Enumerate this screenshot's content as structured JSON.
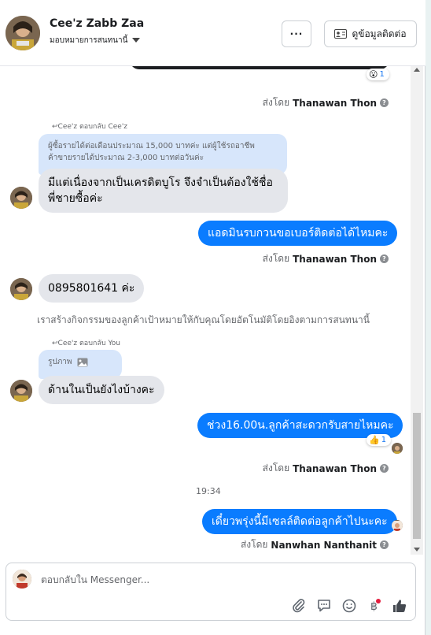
{
  "header": {
    "name": "Cee'z Zabb Zaa",
    "assign": "มอบหมายการสนทนานี้",
    "more_label": "···",
    "contact_label": "ดูข้อมูลติดต่อ"
  },
  "messages": {
    "reaction1": {
      "emoji": "😮",
      "count": "1"
    },
    "sent1": {
      "prefix": "ส่งโดย",
      "name": "Thanawan Thon"
    },
    "reply1_label": "Cee'z ตอบกลับ Cee'z",
    "quote1": "ผู้ซื้อรายได้ต่อเดือนประมาณ 15,000 บาทค่ะ แต่ผู้ใช้รถอาชีพค้าขายรายได้ประมาณ 2-3,000 บาทต่อวันค่ะ",
    "msg_in1": "มีแต่เนื่องจากเป็นเครดิตบูโร  จึงจำเป็นต้องใช้ชื่อพี่ชายซื้อค่ะ",
    "msg_out1": "แอดมินรบกวนขอเบอร์ติดต่อได้ไหมคะ",
    "sent2": {
      "prefix": "ส่งโดย",
      "name": "Thanawan Thon"
    },
    "msg_in2": "0895801641  ค่ะ",
    "system": "เราสร้างกิจกรรมของลูกค้าเป้าหมายให้กับคุณโดยอัตโนมัติโดยอิงตามการสนทนานี้",
    "reply2_label": "Cee'z ตอบกลับ You",
    "quote2": "รูปภาพ",
    "msg_in3": "ด้านในเป็นยังไงบ้างคะ",
    "msg_out2": "ช่วง16.00น.ลูกค้าสะดวกรับสายไหมคะ",
    "reaction2": {
      "emoji": "👍",
      "count": "1"
    },
    "sent3": {
      "prefix": "ส่งโดย",
      "name": "Thanawan Thon"
    },
    "time": "19:34",
    "msg_out3": "เดี๋ยวพรุ่งนี้มีเซลล์ติดต่อลูกค้าไปนะคะ",
    "sent4": {
      "prefix": "ส่งโดย",
      "name": "Nanwhan Nanthanit"
    }
  },
  "composer": {
    "placeholder": "ตอบกลับใน Messenger..."
  },
  "colors": {
    "outgoing": "#0a7cff",
    "incoming": "#e4e6eb",
    "quote": "#d7e6fb"
  }
}
